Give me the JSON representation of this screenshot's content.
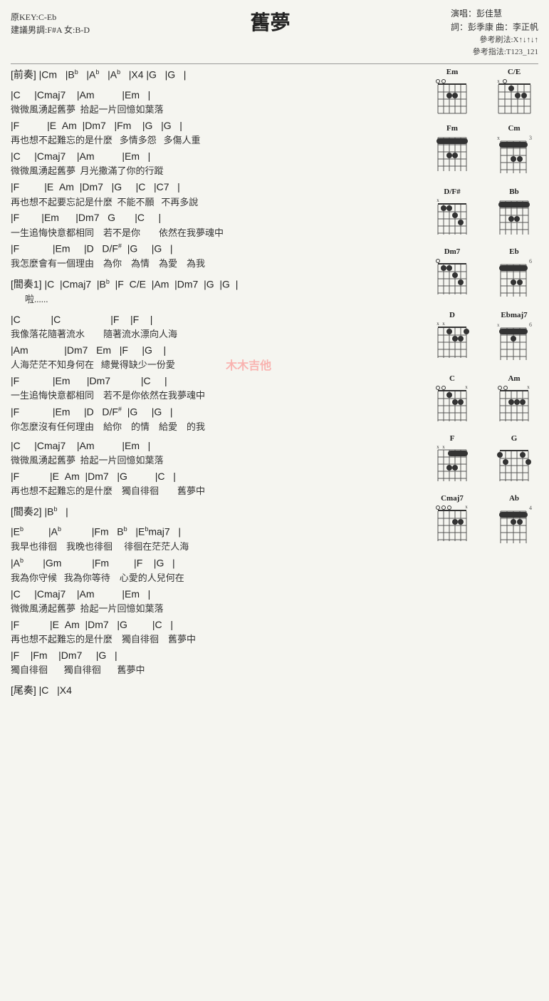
{
  "title": "舊夢",
  "key_info": {
    "original": "原KEY:C-Eb",
    "suggestion": "建議男調:F#A 女:B-D"
  },
  "performer_info": {
    "singer": "演唱：彭佳慧",
    "lyrics": "詞：彭季康  曲：李正帆"
  },
  "strumming": {
    "pattern": "參考刷法:X↑↓↑↓↑",
    "fingering": "參考指法:T123_121"
  },
  "sections": [
    {
      "id": "intro",
      "label": "[前奏]",
      "chords": "|Cm  |B♭  |A♭  |A♭  |X4 |G  |G  |",
      "lyrics": ""
    },
    {
      "id": "verse1a",
      "label": "",
      "chords": "|C    |Cmaj7   |Am         |Em   |",
      "lyrics": "微微風湧起舊夢  拾起一片回憶如葉落"
    },
    {
      "id": "verse1b",
      "chords": "|F           |E  Am  |Dm7   |Fm    |G   |G   |",
      "lyrics": "再也想不起難忘的是什麼   多情多怨  多傷人重"
    },
    {
      "id": "verse1c",
      "chords": "|C    |Cmaj7   |Am         |Em   |",
      "lyrics": "微微風湧起舊夢  月光撒滿了你的行蹤"
    },
    {
      "id": "verse1d",
      "chords": "|F         |E  Am  |Dm7   |G    |C   |C7   |",
      "lyrics": "再也想不起要忘記是什麼  不能不願  不再多說"
    },
    {
      "id": "verse1e",
      "chords": "|F        |Em     |Dm7   G      |C    |",
      "lyrics": "一生追悔快意都相同   若不是你       依然在我夢魂中"
    },
    {
      "id": "verse1f",
      "chords": "|F            |Em    |D   D/F#   |G    |G   |",
      "lyrics": "我怎麼會有一個理由   為你   為情   為愛   為我"
    },
    {
      "id": "interlude1",
      "label": "[間奏1]",
      "chords": "|C  |Cmaj7  |B♭  |F  C/E  |Am  |Dm7  |G  |G  |",
      "lyrics": "啦......"
    },
    {
      "id": "verse2a",
      "chords": "|C         |C                  |F   |F   |",
      "lyrics": "我像落花隨著流水       隨著流水漂向人海"
    },
    {
      "id": "verse2b",
      "chords": "|Am            |Dm7   Em   |F    |G   |",
      "lyrics": "人海茫茫不知身何在   總覺得缺少一份愛"
    },
    {
      "id": "verse2c",
      "chords": "|F            |Em     |Dm7          |C    |",
      "lyrics": "一生追悔快意都相同   若不是你依然在我夢魂中"
    },
    {
      "id": "verse2d",
      "chords": "|F            |Em    |D   D/F#   |G    |G   |",
      "lyrics": "你怎麼沒有任何理由   給你   的情   給愛   的我"
    },
    {
      "id": "verse3a",
      "chords": "|C    |Cmaj7   |Am         |Em   |",
      "lyrics": "微微風湧起舊夢  拾起一片回憶如葉落"
    },
    {
      "id": "verse3b",
      "chords": "|F            |E  Am  |Dm7   |G    |C   |",
      "lyrics": "再也想不起難忘的是什麼   獨自徘徊       舊夢中"
    },
    {
      "id": "interlude2",
      "label": "[間奏2]",
      "chords": "|B♭   |",
      "lyrics": ""
    },
    {
      "id": "bridge1",
      "chords": "|E♭        |A♭          |Fm   B♭   |E♭maj7   |",
      "lyrics": "我早也徘徊   我晚也徘徊    徘徊在茫茫人海"
    },
    {
      "id": "bridge2",
      "chords": "|A♭       |Gm          |Fm         |F    |G   |",
      "lyrics": "我為你守候  我為你等待   心愛的人兒何在"
    },
    {
      "id": "verse4a",
      "chords": "|C    |Cmaj7   |Am         |Em   |",
      "lyrics": "微微風湧起舊夢  拾起一片回憶如葉落"
    },
    {
      "id": "verse4b",
      "chords": "|F            |E  Am  |Dm7   |G    |C   |",
      "lyrics": "再也想不起難忘的是什麼   獨自徘徊   舊夢中"
    },
    {
      "id": "verse4c",
      "chords": "|F   |Fm   |Dm7    |G   |",
      "lyrics": "獨自徘徊       獨自徘徊       舊夢中"
    },
    {
      "id": "outro",
      "label": "[尾奏]",
      "chords": "|C   |X4",
      "lyrics": ""
    }
  ],
  "chord_diagrams": [
    {
      "name": "Em",
      "position": 0,
      "dots": [
        [
          1,
          4
        ],
        [
          2,
          5
        ],
        [
          3,
          5
        ]
      ],
      "open": [
        0,
        1
      ],
      "muted": []
    },
    {
      "name": "C/E",
      "position": 0,
      "dots": [
        [
          2,
          4
        ],
        [
          3,
          5
        ],
        [
          4,
          5
        ]
      ],
      "open": [
        1
      ],
      "muted": [
        0
      ]
    },
    {
      "name": "Fm",
      "position": 0,
      "dots": [
        [
          1,
          1
        ],
        [
          2,
          1
        ],
        [
          3,
          1
        ],
        [
          4,
          1
        ],
        [
          5,
          1
        ],
        [
          6,
          1
        ],
        [
          3,
          3
        ],
        [
          4,
          3
        ]
      ],
      "open": [],
      "muted": []
    },
    {
      "name": "Cm",
      "position": 3,
      "dots": [
        [
          1,
          3
        ],
        [
          2,
          3
        ],
        [
          3,
          3
        ],
        [
          4,
          3
        ],
        [
          5,
          3
        ],
        [
          3,
          5
        ],
        [
          4,
          5
        ]
      ],
      "open": [],
      "muted": []
    },
    {
      "name": "D/F#",
      "position": 0,
      "dots": [
        [
          2,
          2
        ],
        [
          3,
          2
        ],
        [
          4,
          3
        ],
        [
          5,
          4
        ]
      ],
      "open": [],
      "muted": [
        0
      ]
    },
    {
      "name": "Bb",
      "position": 0,
      "dots": [
        [
          1,
          1
        ],
        [
          2,
          1
        ],
        [
          3,
          1
        ],
        [
          4,
          1
        ],
        [
          5,
          1
        ],
        [
          4,
          3
        ],
        [
          5,
          3
        ]
      ],
      "open": [],
      "muted": []
    },
    {
      "name": "Dm7",
      "position": 0,
      "dots": [
        [
          1,
          1
        ],
        [
          2,
          1
        ],
        [
          3,
          2
        ],
        [
          4,
          3
        ]
      ],
      "open": [
        0
      ],
      "muted": []
    },
    {
      "name": "Eb",
      "position": 6,
      "dots": [
        [
          1,
          6
        ],
        [
          2,
          6
        ],
        [
          3,
          6
        ],
        [
          4,
          6
        ],
        [
          5,
          6
        ],
        [
          4,
          8
        ],
        [
          5,
          8
        ]
      ],
      "open": [],
      "muted": []
    },
    {
      "name": "D",
      "position": 0,
      "dots": [
        [
          2,
          2
        ],
        [
          3,
          3
        ],
        [
          4,
          3
        ],
        [
          5,
          2
        ]
      ],
      "open": [],
      "muted": [
        0
      ]
    },
    {
      "name": "Ebmaj7",
      "position": 6,
      "dots": [
        [
          1,
          6
        ],
        [
          2,
          6
        ],
        [
          3,
          6
        ],
        [
          4,
          6
        ],
        [
          3,
          8
        ]
      ],
      "open": [],
      "muted": []
    },
    {
      "name": "C",
      "position": 0,
      "dots": [
        [
          2,
          1
        ],
        [
          3,
          2
        ],
        [
          4,
          2
        ],
        [
          5,
          3
        ]
      ],
      "open": [
        0,
        1
      ],
      "muted": []
    },
    {
      "name": "Am",
      "position": 0,
      "dots": [
        [
          2,
          2
        ],
        [
          3,
          2
        ],
        [
          4,
          2
        ]
      ],
      "open": [
        0,
        1
      ],
      "muted": []
    },
    {
      "name": "F",
      "position": 0,
      "dots": [
        [
          1,
          1
        ],
        [
          2,
          1
        ],
        [
          3,
          1
        ],
        [
          4,
          1
        ],
        [
          5,
          1
        ],
        [
          6,
          1
        ],
        [
          3,
          2
        ],
        [
          4,
          3
        ],
        [
          5,
          3
        ]
      ],
      "open": [],
      "muted": []
    },
    {
      "name": "G",
      "position": 0,
      "dots": [
        [
          1,
          2
        ],
        [
          2,
          3
        ],
        [
          5,
          2
        ],
        [
          6,
          3
        ]
      ],
      "open": [
        2,
        3
      ],
      "muted": []
    },
    {
      "name": "Cmaj7",
      "position": 0,
      "dots": [
        [
          2,
          2
        ],
        [
          3,
          2
        ],
        [
          4,
          2
        ]
      ],
      "open": [
        0,
        1,
        2
      ],
      "muted": []
    },
    {
      "name": "Ab",
      "position": 4,
      "dots": [
        [
          1,
          4
        ],
        [
          2,
          4
        ],
        [
          3,
          4
        ],
        [
          4,
          4
        ],
        [
          5,
          4
        ],
        [
          6,
          4
        ]
      ],
      "open": [],
      "muted": []
    }
  ]
}
